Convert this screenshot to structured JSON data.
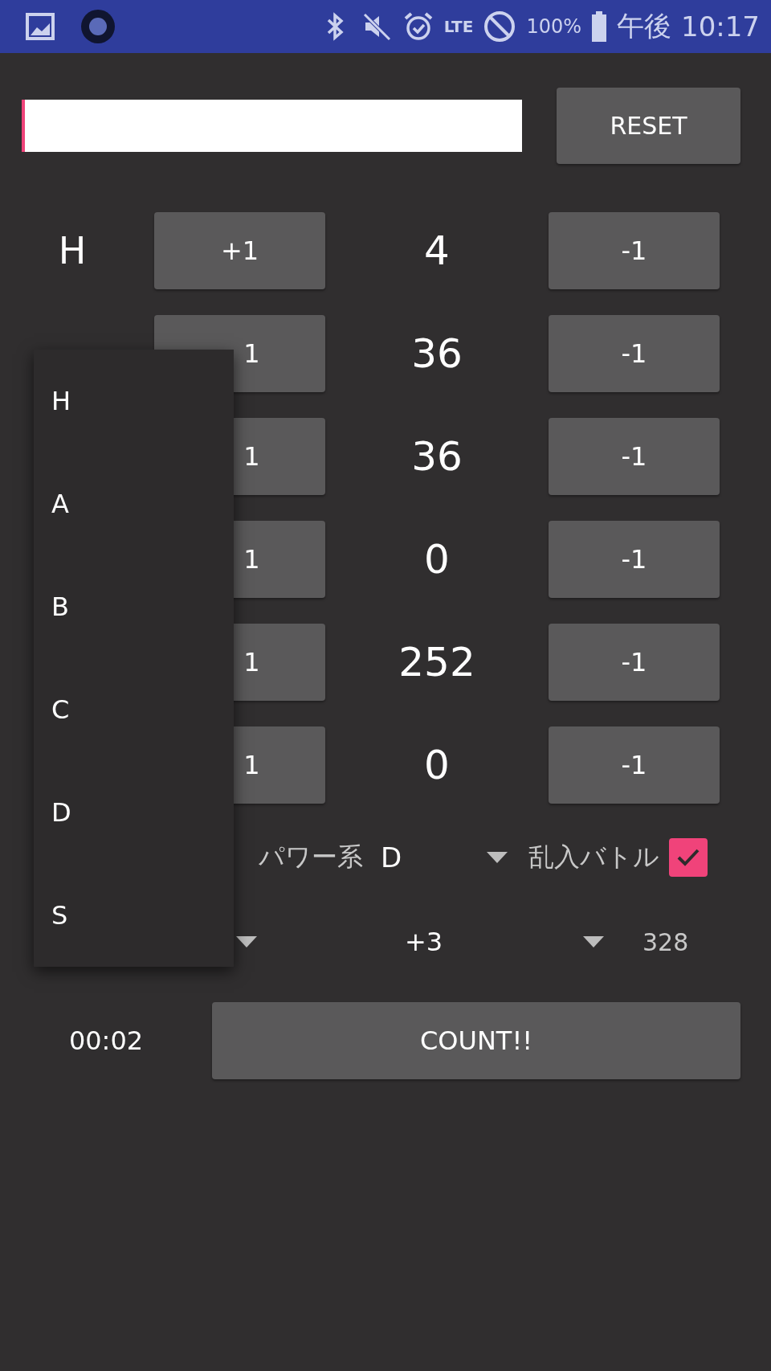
{
  "status_bar": {
    "network": "LTE",
    "battery": "100%",
    "period": "午後",
    "time": "10:17"
  },
  "reset_button": "RESET",
  "stats": [
    {
      "label": "H",
      "plus": "+1",
      "value": "4",
      "minus": "-1"
    },
    {
      "plus": "1",
      "value": "36",
      "minus": "-1"
    },
    {
      "plus": "1",
      "value": "36",
      "minus": "-1"
    },
    {
      "plus": "1",
      "value": "0",
      "minus": "-1"
    },
    {
      "plus": "1",
      "value": "252",
      "minus": "-1"
    },
    {
      "plus": "1",
      "value": "0",
      "minus": "-1"
    }
  ],
  "type_select": {
    "label": "パワー系",
    "value": "D"
  },
  "intrusion": {
    "label": "乱入バトル",
    "checked": true
  },
  "bonus_select": {
    "value": "+3"
  },
  "total": "328",
  "timer": "00:02",
  "count_button": "COUNT!!",
  "menu": {
    "items": [
      "H",
      "A",
      "B",
      "C",
      "D",
      "S"
    ]
  }
}
